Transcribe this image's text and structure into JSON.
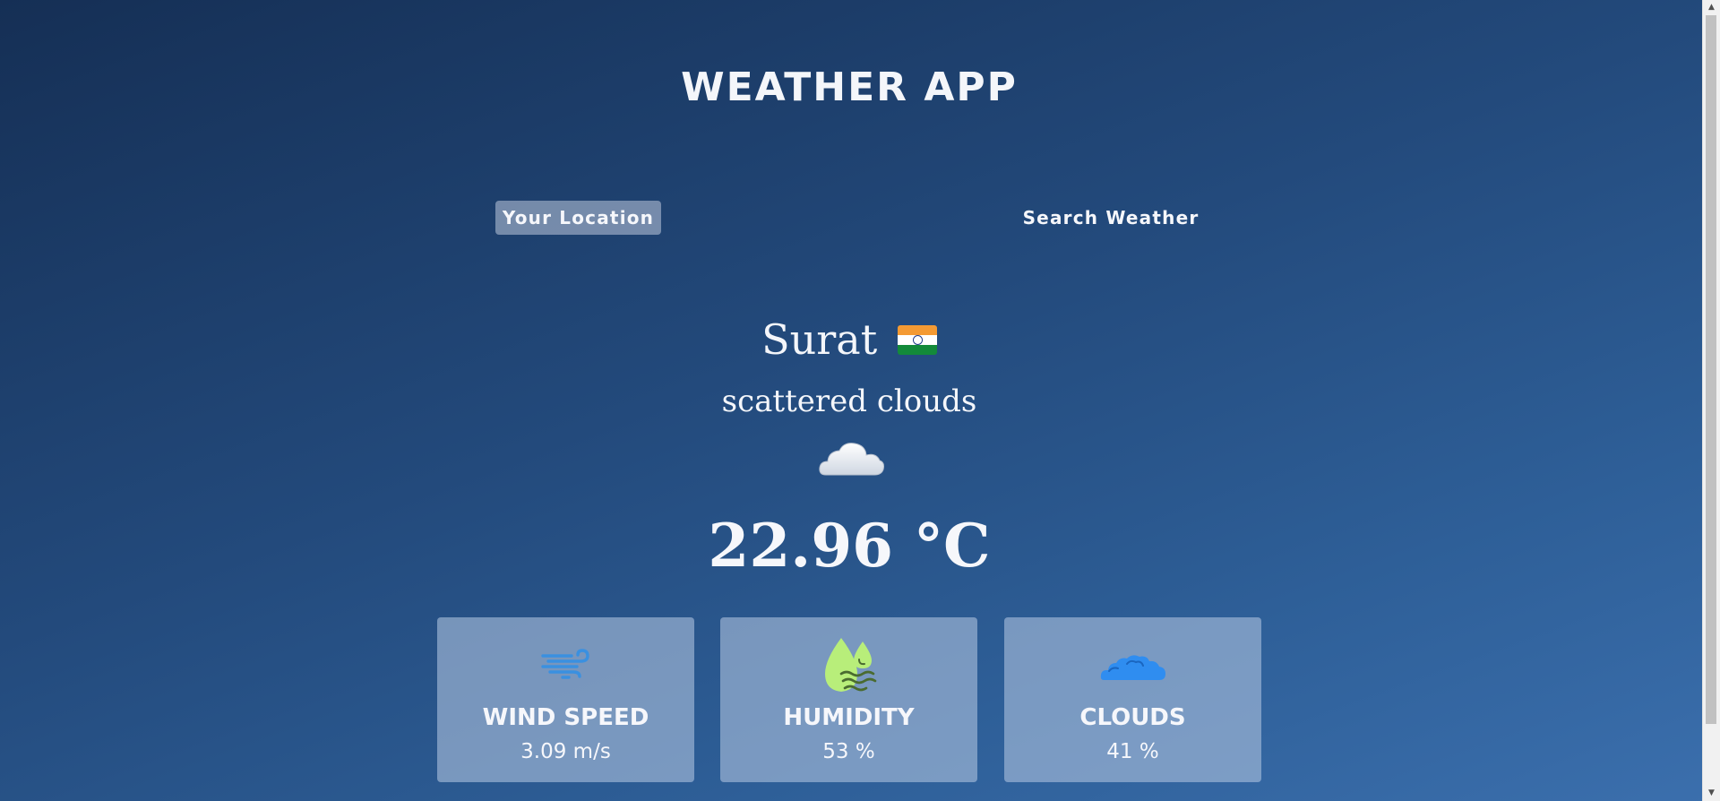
{
  "app": {
    "title": "WEATHER APP"
  },
  "tabs": [
    {
      "label": "Your Location",
      "active": true
    },
    {
      "label": "Search Weather",
      "active": false
    }
  ],
  "current": {
    "city": "Surat",
    "country_flag": "india-flag-icon",
    "description": "scattered clouds",
    "condition_icon": "cloud-icon",
    "temperature": "22.96 °C"
  },
  "stats": [
    {
      "label": "WIND SPEED",
      "value": "3.09 m/s",
      "icon": "wind-icon"
    },
    {
      "label": "HUMIDITY",
      "value": "53 %",
      "icon": "humidity-icon"
    },
    {
      "label": "CLOUDS",
      "value": "41 %",
      "icon": "clouds-icon"
    }
  ],
  "colors": {
    "bg_top": "#152f55",
    "bg_bottom": "#3b6fad",
    "card_bg": "#aabedc",
    "wind_icon": "#3a90e0",
    "humidity_icon": "#b8ee7a",
    "clouds_icon": "#2f8df0"
  }
}
